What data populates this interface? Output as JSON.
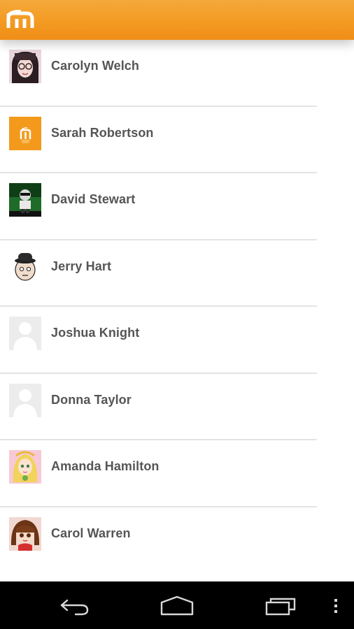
{
  "app": {
    "logo_icon": "moodle-m-logo",
    "bar_color": "#f39a22"
  },
  "contacts": [
    {
      "name": "Carolyn Welch",
      "avatar": "photo-glasses-woman"
    },
    {
      "name": "Sarah Robertson",
      "avatar": "orange-moodle-logo"
    },
    {
      "name": "David Stewart",
      "avatar": "cartoon-man-green-bg"
    },
    {
      "name": "Jerry Hart",
      "avatar": "cartoon-face-bowler-hat"
    },
    {
      "name": "Joshua Knight",
      "avatar": "default-user-silhouette"
    },
    {
      "name": "Donna Taylor",
      "avatar": "default-user-silhouette"
    },
    {
      "name": "Amanda Hamilton",
      "avatar": "cartoon-blonde-girl"
    },
    {
      "name": "Carol Warren",
      "avatar": "cartoon-brown-hair-girl"
    }
  ],
  "navigation": {
    "back_icon": "back-arrow-icon",
    "home_icon": "home-icon",
    "recents_icon": "recent-apps-icon",
    "menu_icon": "overflow-menu-icon"
  }
}
